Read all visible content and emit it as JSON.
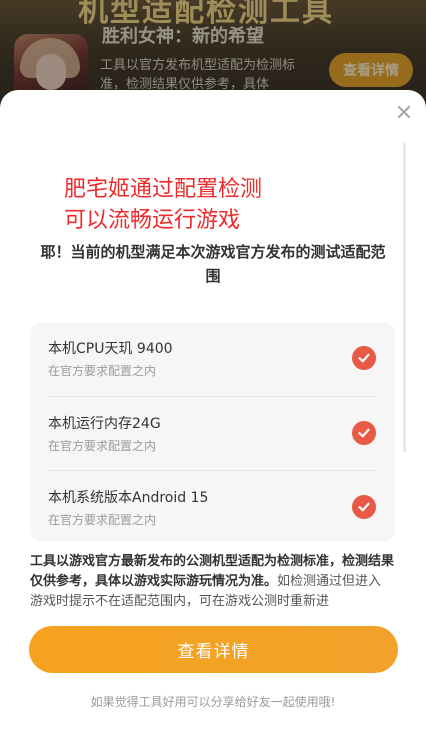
{
  "background": {
    "banner_title": "机型适配检测工具",
    "game_name": "胜利女神：新的希望",
    "description": "工具以官方发布机型适配为检测标准，检测结果仅供参考，具体",
    "details_button": "查看详情"
  },
  "sheet": {
    "close_icon": "close-icon",
    "headline_line1": "肥宅姬通过配置检测",
    "headline_line2": "可以流畅运行游戏",
    "subhead": "耶！当前的机型满足本次游戏官方发布的测试适配范围",
    "checks": [
      {
        "title": "本机CPU天玑 9400",
        "status": "在官方要求配置之内",
        "icon": "check-circle-icon"
      },
      {
        "title": "本机运行内存24G",
        "status": "在官方要求配置之内",
        "icon": "check-circle-icon"
      },
      {
        "title": "本机系统版本Android 15",
        "status": "在官方要求配置之内",
        "icon": "check-circle-icon"
      }
    ],
    "notice_bold": "工具以游戏官方最新发布的公测机型适配为检测标准，检测结果仅供参考，具体以游戏实际游玩情况为准。",
    "notice_rest": "如检测通过但进入游戏时提示不在适配范围内，可在游戏公测时重新进",
    "primary_button": "查看详情",
    "footer": "如果觉得工具好用可以分享给好友一起使用哦!"
  },
  "colors": {
    "accent_orange": "#f6a21f",
    "headline_red": "#ee2b2b",
    "check_red": "#e85a46"
  }
}
